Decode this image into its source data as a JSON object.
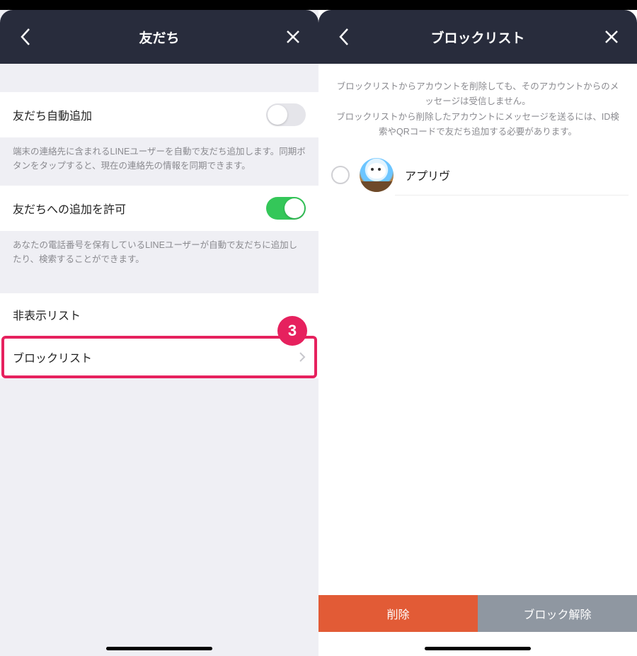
{
  "left": {
    "header": {
      "title": "友だち"
    },
    "rows": {
      "autoAdd": {
        "label": "友だち自動追加",
        "desc": "端末の連絡先に含まれるLINEユーザーを自動で友だち追加します。同期ボタンをタップすると、現在の連絡先の情報を同期できます。"
      },
      "allowAdd": {
        "label": "友だちへの追加を許可",
        "desc": "あなたの電話番号を保有しているLINEユーザーが自動で友だちに追加したり、検索することができます。"
      },
      "hiddenList": {
        "label": "非表示リスト"
      },
      "blockList": {
        "label": "ブロックリスト"
      }
    },
    "annotation": {
      "number": "3"
    }
  },
  "right": {
    "header": {
      "title": "ブロックリスト"
    },
    "info": "ブロックリストからアカウントを削除しても、そのアカウントからのメッセージは受信しません。\nブロックリストから削除したアカウントにメッセージを送るには、ID検索やQRコードで友だち追加する必要があります。",
    "items": [
      {
        "name": "アプリヴ"
      }
    ],
    "buttons": {
      "delete": "削除",
      "unblock": "ブロック解除"
    }
  }
}
